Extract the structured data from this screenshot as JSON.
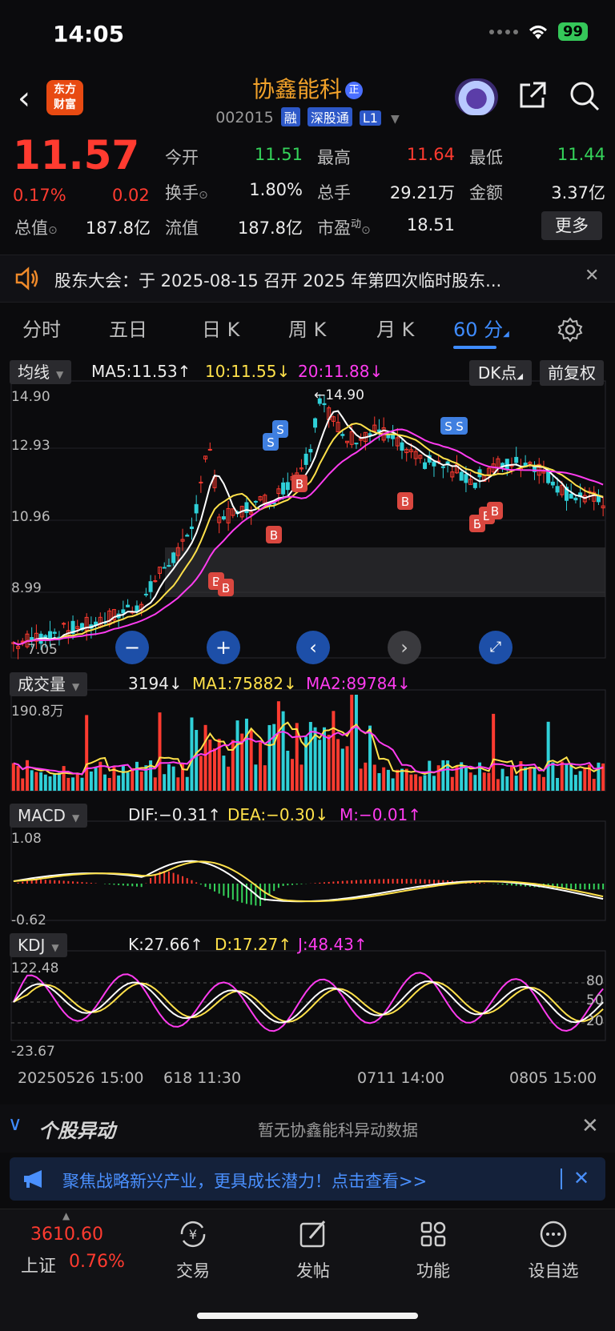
{
  "status": {
    "time": "14:05",
    "battery": "99"
  },
  "header": {
    "logo_line1": "东方",
    "logo_line2": "财富",
    "stock_name": "协鑫能科",
    "name_badge": "正",
    "code": "002015",
    "tags": [
      "融",
      "深股通",
      "L1"
    ]
  },
  "quote": {
    "price": "11.57",
    "change_pct": "0.17%",
    "change": "0.02",
    "fields": {
      "open_label": "今开",
      "open": "11.51",
      "high_label": "最高",
      "high": "11.64",
      "low_label": "最低",
      "low": "11.44",
      "turnover_label": "换手",
      "turnover": "1.80%",
      "volume_label": "总手",
      "volume": "29.21万",
      "amount_label": "金额",
      "amount": "3.37亿",
      "mktcap_label": "总值",
      "mktcap": "187.8亿",
      "float_label": "流值",
      "float": "187.8亿",
      "pe_label": "市盈",
      "pe_sup": "动",
      "pe": "18.51"
    },
    "more_label": "更多"
  },
  "notice": {
    "text": "股东大会：于 2025-08-15 召开 2025 年第四次临时股东..."
  },
  "tabs": [
    "分时",
    "五日",
    "日 K",
    "周 K",
    "月 K",
    "60 分"
  ],
  "active_tab": 5,
  "kline": {
    "indicator": "均线",
    "ma5": "MA5:11.53",
    "ma10": "10:11.55",
    "ma20": "20:11.88",
    "dk_label": "DK点",
    "fuquan_label": "前复权",
    "y_labels": [
      "14.90",
      "12.93",
      "10.96",
      "8.99",
      "7.05"
    ],
    "max_label": "14.90"
  },
  "volume": {
    "indicator": "成交量",
    "value": "3194",
    "ma1": "MA1:75882",
    "ma2": "MA2:89784",
    "y_top": "190.8万"
  },
  "macd": {
    "indicator": "MACD",
    "dif": "DIF:−0.31",
    "dea": "DEA:−0.30",
    "m": "M:−0.01",
    "y_top": "1.08",
    "y_bottom": "-0.62"
  },
  "kdj": {
    "indicator": "KDJ",
    "k": "K:27.66",
    "d": "D:17.27",
    "j": "J:48.43",
    "y_top": "122.48",
    "y_bottom": "-23.67",
    "levels": [
      "80",
      "50",
      "20"
    ]
  },
  "x_axis": [
    "20250526 15:00",
    "618 11:30",
    "0711 14:00",
    "0805 15:00"
  ],
  "yidong": {
    "title": "个股异动",
    "text": "暂无协鑫能科异动数据"
  },
  "promo": {
    "text": "聚焦战略新兴产业，更具成长潜力！点击查看>>"
  },
  "bottom_bar": {
    "index_value": "3610.60",
    "index_name": "上证",
    "index_pct": "0.76%",
    "items": [
      "交易",
      "发帖",
      "功能",
      "设自选"
    ]
  },
  "colors": {
    "up": "#ff3b30",
    "down": "#35d35a",
    "accent": "#3f8cff",
    "ma5": "#ffffff",
    "ma10": "#ffe14a",
    "ma20": "#ff3cf0",
    "vol_down": "#2fd0d8"
  }
}
